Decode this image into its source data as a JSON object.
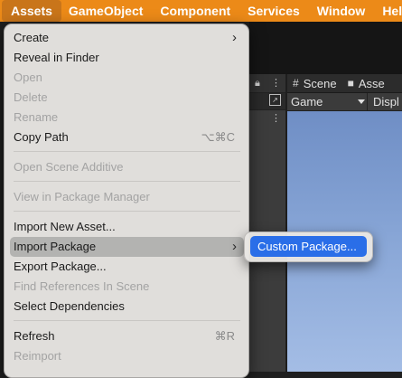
{
  "menubar": {
    "items": [
      "Assets",
      "GameObject",
      "Component",
      "Services",
      "Window",
      "Help"
    ]
  },
  "editor": {
    "tabs": [
      {
        "label": "Scene",
        "icon": "grid-icon"
      },
      {
        "label": "Asse",
        "icon": "lock-icon"
      }
    ],
    "game_dropdown": "Game",
    "display_label": "Displ"
  },
  "menu": {
    "items": [
      {
        "label": "Create",
        "enabled": true,
        "submenu": true
      },
      {
        "label": "Reveal in Finder",
        "enabled": true
      },
      {
        "label": "Open",
        "enabled": false
      },
      {
        "label": "Delete",
        "enabled": false
      },
      {
        "label": "Rename",
        "enabled": false
      },
      {
        "label": "Copy Path",
        "enabled": true,
        "shortcut": "⌥⌘C"
      },
      {
        "label": "Open Scene Additive",
        "enabled": false
      },
      {
        "label": "View in Package Manager",
        "enabled": false
      },
      {
        "label": "Import New Asset...",
        "enabled": true
      },
      {
        "label": "Import Package",
        "enabled": true,
        "submenu": true,
        "highlighted": true
      },
      {
        "label": "Export Package...",
        "enabled": true
      },
      {
        "label": "Find References In Scene",
        "enabled": false
      },
      {
        "label": "Select Dependencies",
        "enabled": true
      },
      {
        "label": "Refresh",
        "enabled": true,
        "shortcut": "⌘R"
      },
      {
        "label": "Reimport",
        "enabled": false
      }
    ]
  },
  "submenu": {
    "items": [
      {
        "label": "Custom Package..."
      }
    ]
  },
  "colors": {
    "menubar": "#ec8a18",
    "highlight": "#2a6ee8"
  }
}
